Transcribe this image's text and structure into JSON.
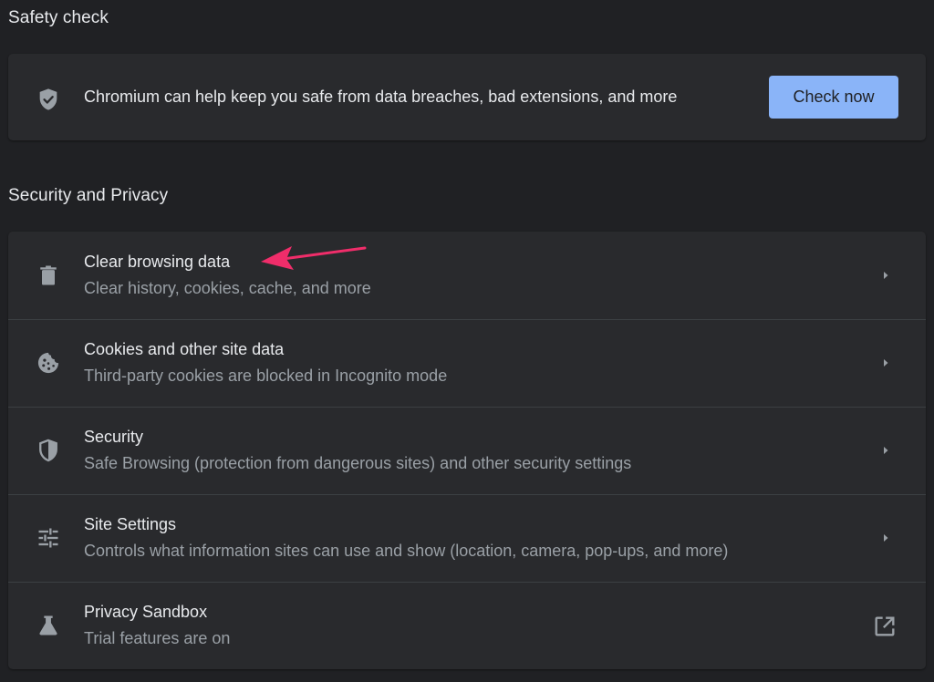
{
  "safety_check": {
    "title": "Safety check",
    "description": "Chromium can help keep you safe from data breaches, bad extensions, and more",
    "button_label": "Check now",
    "icon": "shield-check-icon"
  },
  "security_privacy": {
    "title": "Security and Privacy",
    "items": [
      {
        "title": "Clear browsing data",
        "subtitle": "Clear history, cookies, cache, and more",
        "icon": "trash-icon",
        "action": "chevron-right-icon"
      },
      {
        "title": "Cookies and other site data",
        "subtitle": "Third-party cookies are blocked in Incognito mode",
        "icon": "cookie-icon",
        "action": "chevron-right-icon"
      },
      {
        "title": "Security",
        "subtitle": "Safe Browsing (protection from dangerous sites) and other security settings",
        "icon": "shield-half-icon",
        "action": "chevron-right-icon"
      },
      {
        "title": "Site Settings",
        "subtitle": "Controls what information sites can use and show (location, camera, pop-ups, and more)",
        "icon": "tune-sliders-icon",
        "action": "chevron-right-icon"
      },
      {
        "title": "Privacy Sandbox",
        "subtitle": "Trial features are on",
        "icon": "flask-icon",
        "action": "open-in-new-icon"
      }
    ]
  },
  "colors": {
    "background": "#202124",
    "card": "#292a2d",
    "divider": "#3c4043",
    "primary_text": "#e8eaed",
    "secondary_text": "#9aa0a6",
    "accent_button": "#8ab4f8",
    "icon": "#9aa0a6",
    "annotation_arrow": "#f02d6a"
  }
}
